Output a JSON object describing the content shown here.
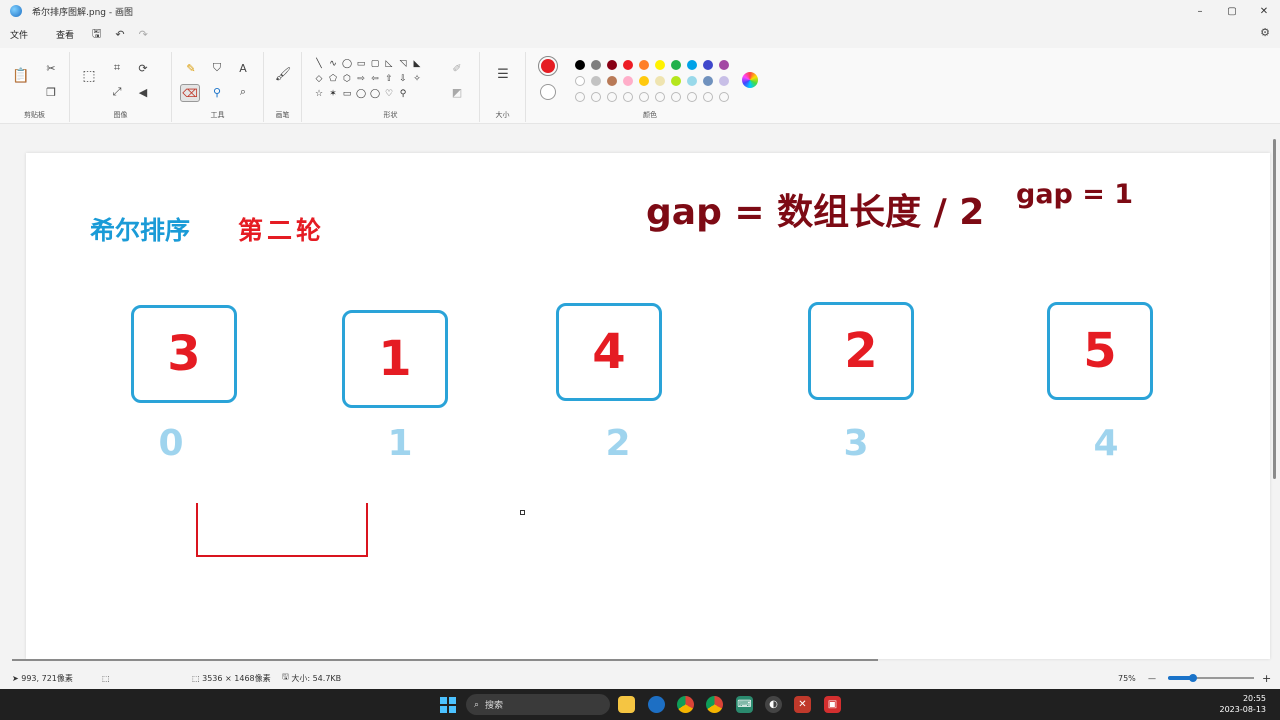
{
  "window": {
    "title": "希尔排序图解.png - 画图",
    "minimize": "–",
    "maximize": "▢",
    "close": "✕"
  },
  "menu": {
    "file": "文件",
    "view": "查看"
  },
  "ribbon": {
    "clipboard_label": "剪贴板",
    "image_label": "图像",
    "tools_label": "工具",
    "brushes_label": "画笔",
    "shapes_label": "形状",
    "size_label": "大小",
    "colors_label": "颜色",
    "text_tool": "A",
    "shapes": [
      "╲",
      "∿",
      "◯",
      "▭",
      "▢",
      "◺",
      "◹",
      "◣",
      "",
      "◇",
      "⬠",
      "⬡",
      "⇨",
      "⇦",
      "⇧",
      "⇩",
      "✧",
      "",
      "☆",
      "✶",
      "▭",
      "◯",
      "◯",
      "♡",
      "⚲",
      "",
      ""
    ],
    "colors": {
      "primary": "#e51c23",
      "row1": [
        "#000000",
        "#7f7f7f",
        "#880015",
        "#ed1c24",
        "#ff7f27",
        "#fff200",
        "#22b14c",
        "#00a2e8",
        "#3f48cc",
        "#a349a4"
      ],
      "row2": [
        "#ffffff",
        "#c3c3c3",
        "#b97a57",
        "#ffaec9",
        "#ffc90e",
        "#efe4b0",
        "#b5e61d",
        "#99d9ea",
        "#7092be",
        "#c8bfe7"
      ]
    }
  },
  "canvas": {
    "title_left": "希尔排序",
    "title_round": "第二轮",
    "title_gap": "gap = 数组长度 / 2",
    "title_gap_value": "gap = 1",
    "boxes": [
      {
        "value": "3",
        "index": "0"
      },
      {
        "value": "1",
        "index": "1"
      },
      {
        "value": "4",
        "index": "2"
      },
      {
        "value": "2",
        "index": "3"
      },
      {
        "value": "5",
        "index": "4"
      }
    ]
  },
  "status": {
    "cursor_pos": "993, 721像素",
    "image_size": "3536 × 1468像素",
    "file_size": "大小: 54.7KB",
    "zoom": "75%",
    "zoom_minus": "—",
    "zoom_plus": "+"
  },
  "taskbar": {
    "search": "搜索",
    "time": "20:55",
    "date": "2023-08-13"
  }
}
